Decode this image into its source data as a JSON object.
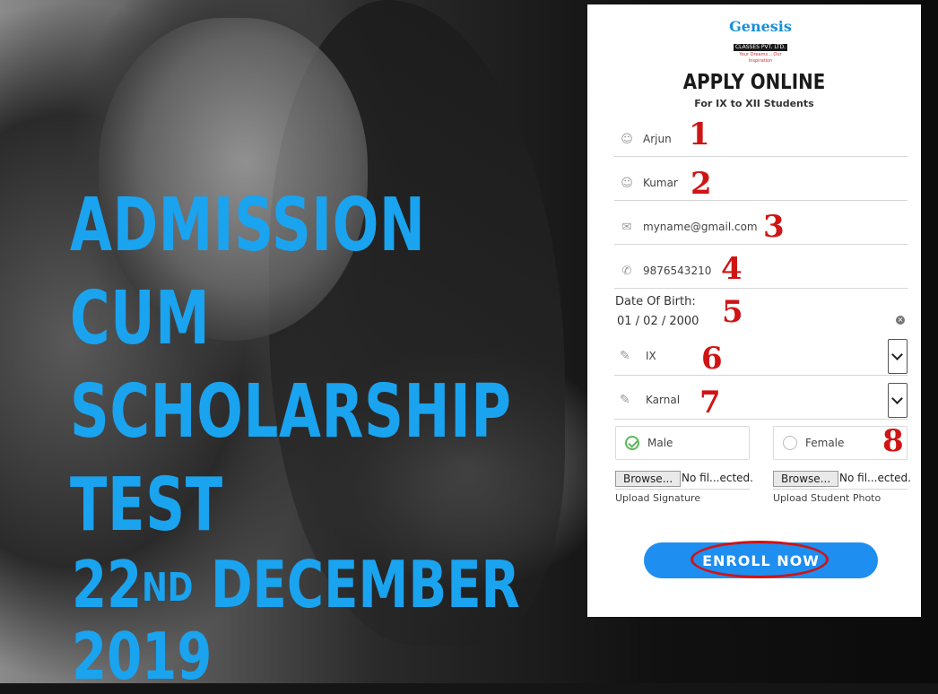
{
  "banner": {
    "lines": [
      "ADMISSION",
      "CUM",
      "SCHOLARSHIP",
      "TEST"
    ],
    "date_day": "22",
    "date_suffix": "ND",
    "date_rest": "DECEMBER",
    "year": "2019",
    "text_color": "#1aa3ef"
  },
  "form": {
    "logo": {
      "brand": "Genesis",
      "sub": "CLASSES PVT. LTD.",
      "tag": "Your Dreams... Our Inspiration"
    },
    "title": "APPLY ONLINE",
    "subtitle": "For IX to XII Students",
    "first_name": "Arjun",
    "last_name": "Kumar",
    "email": "myname@gmail.com",
    "phone": "9876543210",
    "dob_label": "Date Of Birth:",
    "dob_value": "01 / 02 / 2000",
    "class_value": "IX",
    "city_value": "Karnal",
    "gender_options": [
      "Male",
      "Female"
    ],
    "gender_selected": "Male",
    "file_button": "Browse...",
    "file_name": "No fil...ected.",
    "signature_caption": "Upload Signature",
    "photo_caption": "Upload Student Photo",
    "enroll_label": "ENROLL NOW",
    "accent_color": "#1e8ef0"
  },
  "annotations": [
    "1",
    "2",
    "3",
    "4",
    "5",
    "6",
    "7",
    "8"
  ]
}
